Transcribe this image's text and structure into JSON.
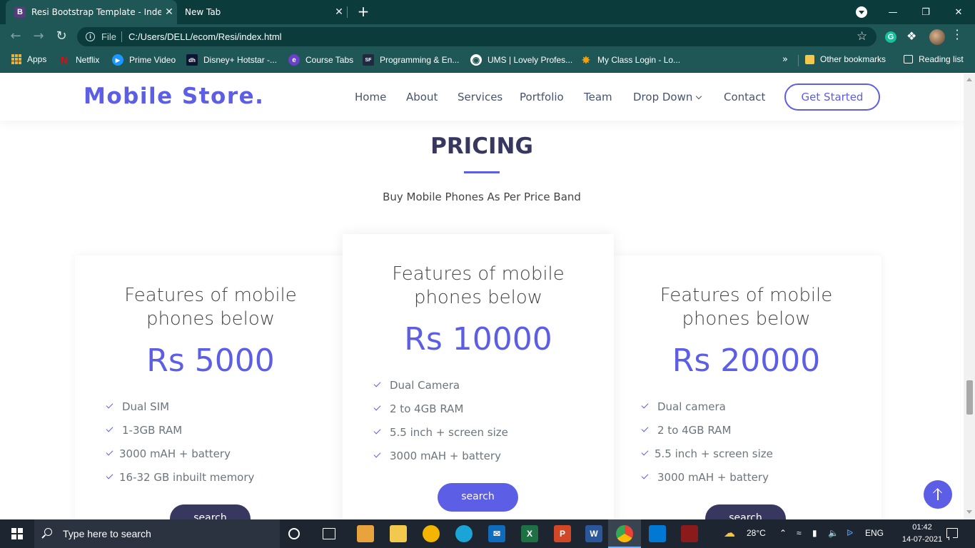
{
  "browser": {
    "tabs": [
      {
        "title": "Resi Bootstrap Template - Index",
        "favicon": "B"
      },
      {
        "title": "New Tab"
      }
    ],
    "new_tab_symbol": "+",
    "close_symbol": "✕",
    "address": {
      "scheme_label": "File",
      "url": "C:/Users/DELL/ecom/Resi/index.html"
    },
    "extension_letter": "G",
    "bookmarks": [
      {
        "label": "Apps",
        "icon": "apps-grid-icon"
      },
      {
        "label": "Netflix",
        "icon": "netflix-icon",
        "color": "#e50914",
        "glyph": "N"
      },
      {
        "label": "Prime Video",
        "icon": "prime-video-icon",
        "color": "#1a98ff",
        "glyph": "▶"
      },
      {
        "label": "Disney+ Hotstar -...",
        "icon": "hotstar-icon",
        "color": "#0c1633",
        "glyph": "dh"
      },
      {
        "label": "Course Tabs",
        "icon": "course-tabs-icon",
        "color": "#6a3fc9",
        "glyph": "e"
      },
      {
        "label": "Programming & En...",
        "icon": "programming-icon",
        "color": "#1f2940",
        "glyph": "SF"
      },
      {
        "label": "UMS | Lovely Profes...",
        "icon": "globe-icon",
        "color": "#ffffff",
        "glyph": "◉"
      },
      {
        "label": "My Class Login - Lo...",
        "icon": "class-login-icon",
        "color": "#f59e0b",
        "glyph": "✸"
      }
    ],
    "more_bookmarks": "»",
    "other_bookmarks": "Other bookmarks",
    "reading_list": "Reading list"
  },
  "site": {
    "logo": "Mobile Store.",
    "nav": [
      "Home",
      "About",
      "Services",
      "Portfolio",
      "Team",
      "Drop Down",
      "Contact"
    ],
    "cta": "Get Started",
    "accent": "#5d5ee6"
  },
  "pricing": {
    "title": "PRICING",
    "subtitle": "Buy Mobile Phones As Per Price Band",
    "cards": [
      {
        "heading_line1": "Features of mobile",
        "heading_line2": "phones below",
        "price": "Rs 5000",
        "features": [
          "Dual SIM",
          "1-3GB RAM",
          "3000 mAH + battery",
          "16-32 GB inbuilt memory"
        ],
        "button": "search",
        "button_color": "#37375f"
      },
      {
        "heading_line1": "Features of mobile",
        "heading_line2": "phones below",
        "price": "Rs 10000",
        "features": [
          "Dual Camera",
          "2 to 4GB RAM",
          "5.5 inch + screen size",
          "3000 mAH + battery"
        ],
        "button": "search",
        "button_color": "#5d5ee6"
      },
      {
        "heading_line1": "Features of mobile",
        "heading_line2": "phones below",
        "price": "Rs 20000",
        "features": [
          "Dual camera",
          "2 to 4GB RAM",
          "5.5 inch + screen size",
          "3000 mAH + battery"
        ],
        "button": "search",
        "button_color": "#37375f"
      }
    ]
  },
  "taskbar": {
    "search_placeholder": "Type here to search",
    "weather": "28°C",
    "language": "ENG",
    "time": "01:42",
    "date": "14-07-2021"
  }
}
